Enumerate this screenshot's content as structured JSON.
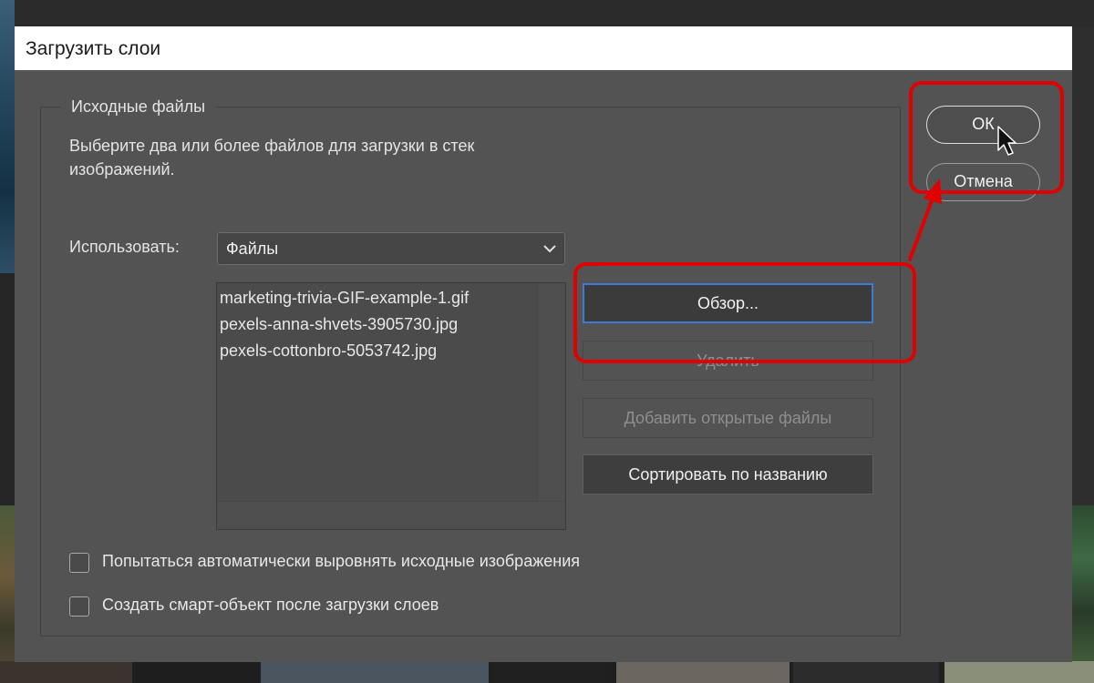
{
  "dialog": {
    "title": "Загрузить слои",
    "source_group": {
      "legend": "Исходные файлы",
      "description": "Выберите два или более файлов для загрузки в стек изображений.",
      "use_label": "Использовать:",
      "use_value": "Файлы",
      "files": [
        "marketing-trivia-GIF-example-1.gif",
        "pexels-anna-shvets-3905730.jpg",
        "pexels-cottonbro-5053742.jpg"
      ]
    },
    "buttons": {
      "browse": "Обзор...",
      "delete": "Удалить",
      "add_open": "Добавить открытые файлы",
      "sort": "Сортировать по названию",
      "ok": "ОК",
      "cancel": "Отмена"
    },
    "checkboxes": [
      {
        "label": "Попытаться автоматически выровнять исходные изображения",
        "checked": false
      },
      {
        "label": "Создать смарт-объект после загрузки слоев",
        "checked": false
      }
    ]
  },
  "colors": {
    "dialog_bg": "#535353",
    "highlight": "#e10000",
    "focus": "#3f7bd4"
  }
}
